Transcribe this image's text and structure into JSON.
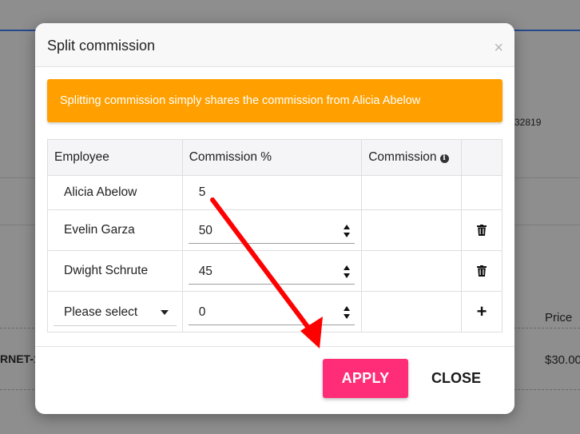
{
  "background": {
    "id_fragment": "32819",
    "price_header": "Price",
    "row_label": "RNET-1)",
    "row_price": "$30.00"
  },
  "modal": {
    "title": "Split commission",
    "close_symbol": "×",
    "alert_text": "Splitting commission simply shares the commission from Alicia Abelow",
    "alert_color": "#ffa000",
    "table": {
      "headers": {
        "employee": "Employee",
        "commission_pct": "Commission %",
        "commission": "Commission"
      },
      "rows": [
        {
          "employee": "Alicia Abelow",
          "percent": "5",
          "commission": ""
        },
        {
          "employee": "Evelin Garza",
          "percent": "50",
          "commission": ""
        },
        {
          "employee": "Dwight Schrute",
          "percent": "45",
          "commission": ""
        }
      ],
      "new_row": {
        "select_value": "Please select",
        "percent": "0"
      }
    },
    "buttons": {
      "apply": "APPLY",
      "close": "CLOSE"
    },
    "apply_color": "#ff2d78"
  },
  "annotation": {
    "arrow_color": "#ff0000"
  },
  "icons": {
    "trash": "trash-icon",
    "plus": "plus-icon",
    "info": "info-icon",
    "caret": "caret-down-icon"
  }
}
